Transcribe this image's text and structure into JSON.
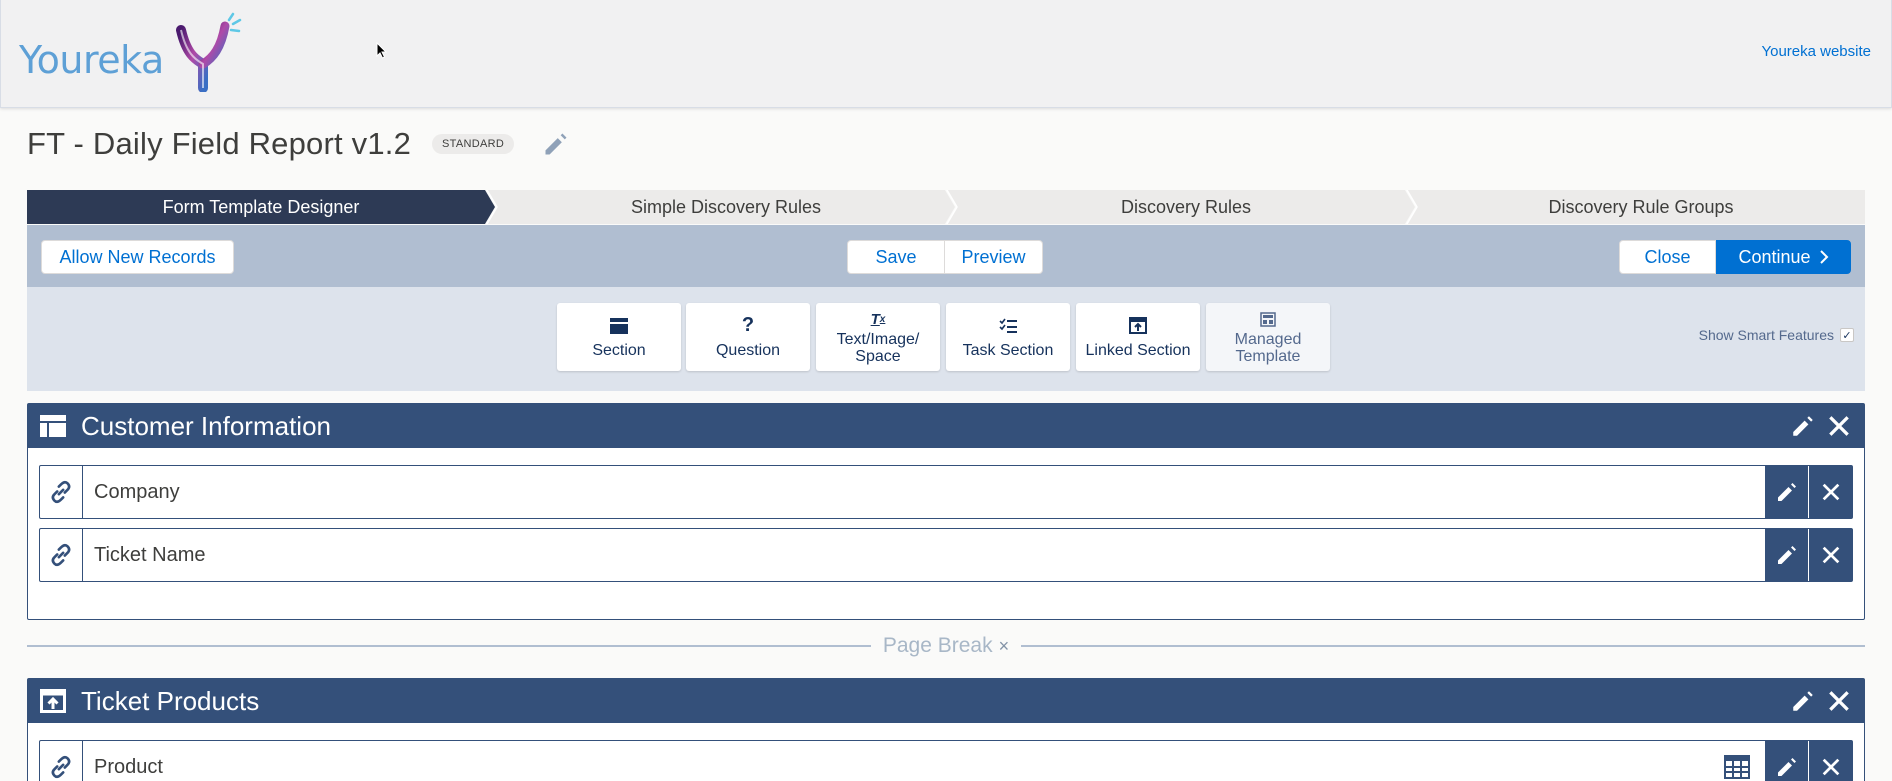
{
  "header": {
    "logo_text": "Youreka",
    "website_link": "Youreka website"
  },
  "title": {
    "text": "FT - Daily Field Report v1.2",
    "badge": "STANDARD"
  },
  "path": {
    "steps": [
      {
        "label": "Form Template Designer",
        "active": true
      },
      {
        "label": "Simple Discovery Rules",
        "active": false
      },
      {
        "label": "Discovery Rules",
        "active": false
      },
      {
        "label": "Discovery Rule Groups",
        "active": false
      }
    ]
  },
  "toolbar": {
    "allow_new_records": "Allow New Records",
    "save": "Save",
    "preview": "Preview",
    "close": "Close",
    "continue": "Continue"
  },
  "palette": {
    "tiles": [
      {
        "label": "Section",
        "icon": "section-icon"
      },
      {
        "label": "Question",
        "icon": "question-icon"
      },
      {
        "label": "Text/Image/\nSpace",
        "icon": "text-format-icon"
      },
      {
        "label": "Task Section",
        "icon": "checklist-icon"
      },
      {
        "label": "Linked Section",
        "icon": "linked-section-icon"
      },
      {
        "label": "Managed\nTemplate",
        "icon": "template-icon"
      }
    ],
    "smart_features_label": "Show Smart Features",
    "smart_features_checked": true
  },
  "sections": [
    {
      "title": "Customer Information",
      "icon": "table-icon",
      "questions": [
        {
          "label": "Company"
        },
        {
          "label": "Ticket Name"
        }
      ]
    },
    {
      "title": "Ticket Products",
      "icon": "linked-section-icon",
      "questions": [
        {
          "label": "Product"
        }
      ]
    }
  ],
  "page_break": {
    "label": "Page Break",
    "remove_glyph": "×"
  },
  "colors": {
    "brand": "#0070d2",
    "navy": "#34507a",
    "path_active": "#2d3a55",
    "band": "#b0bed1"
  }
}
